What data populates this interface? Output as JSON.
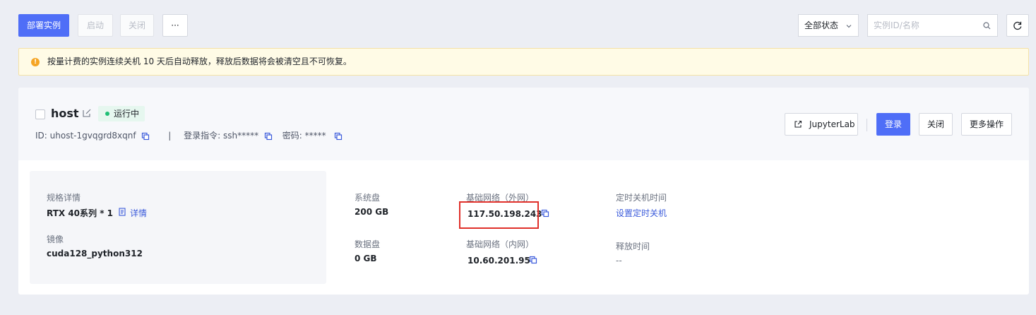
{
  "toolbar": {
    "deploy_label": "部署实例",
    "start_label": "启动",
    "close_label": "关闭",
    "more_label": "···",
    "status_select": "全部状态",
    "search_placeholder": "实例ID/名称"
  },
  "notice": {
    "text": "按量计费的实例连续关机 10 天后自动释放，释放后数据将会被清空且不可恢复。"
  },
  "instance": {
    "name": "host",
    "status": "运行中",
    "id_text": "ID: uhost-1gvqgrd8xqnf",
    "separator": "|",
    "login_cmd": "登录指令: ssh*****",
    "password": "密码: *****",
    "actions": {
      "jupyter": "JupyterLab",
      "login": "登录",
      "close": "关闭",
      "more": "更多操作"
    },
    "spec": {
      "spec_label": "规格详情",
      "spec_value": "RTX 40系列 * 1",
      "detail_link": "详情",
      "image_label": "镜像",
      "image_value": "cuda128_python312"
    },
    "disk": {
      "system_label": "系统盘",
      "system_value": "200 GB",
      "data_label": "数据盘",
      "data_value": "0 GB"
    },
    "network": {
      "public_label": "基础网络（外网）",
      "public_ip": "117.50.198.243",
      "private_label": "基础网络（内网）",
      "private_ip": "10.60.201.95"
    },
    "schedule": {
      "shutdown_label": "定时关机时间",
      "shutdown_link": "设置定时关机",
      "release_label": "释放时间",
      "release_value": "--"
    }
  },
  "colors": {
    "primary": "#4f6ef7",
    "link": "#3b5bdb",
    "status_green": "#1fbf75",
    "highlight_red": "#e0302a",
    "notice_bg": "#fffbe6"
  }
}
